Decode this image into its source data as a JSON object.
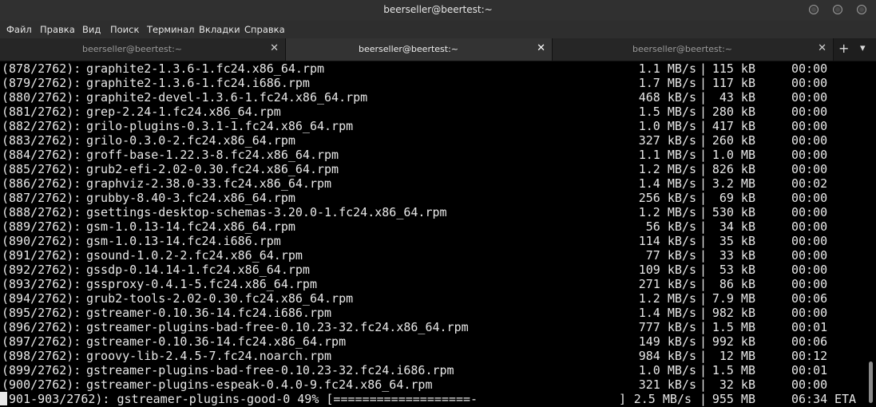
{
  "window": {
    "title": "beerseller@beertest:~"
  },
  "menu": [
    "Файл",
    "Правка",
    "Вид",
    "Поиск",
    "Терминал",
    "Вкладки",
    "Справка"
  ],
  "tabs": [
    {
      "label": "beerseller@beertest:~",
      "active": false
    },
    {
      "label": "beerseller@beertest:~",
      "active": true
    },
    {
      "label": "beerseller@beertest:~",
      "active": false
    }
  ],
  "tab_controls": {
    "new_tab": "+",
    "menu": "▾",
    "close": "✕"
  },
  "terminal": {
    "lines": [
      {
        "idx": "(878/2762):",
        "name": "graphite2-1.3.6-1.fc24.x86_64.rpm",
        "speed": "1.1 MB/s",
        "size": "115 kB",
        "eta": "00:00"
      },
      {
        "idx": "(879/2762):",
        "name": "graphite2-1.3.6-1.fc24.i686.rpm",
        "speed": "1.7 MB/s",
        "size": "117 kB",
        "eta": "00:00"
      },
      {
        "idx": "(880/2762):",
        "name": "graphite2-devel-1.3.6-1.fc24.x86_64.rpm",
        "speed": "468 kB/s",
        "size": "43 kB",
        "eta": "00:00"
      },
      {
        "idx": "(881/2762):",
        "name": "grep-2.24-1.fc24.x86_64.rpm",
        "speed": "1.5 MB/s",
        "size": "280 kB",
        "eta": "00:00"
      },
      {
        "idx": "(882/2762):",
        "name": "grilo-plugins-0.3.1-1.fc24.x86_64.rpm",
        "speed": "1.0 MB/s",
        "size": "417 kB",
        "eta": "00:00"
      },
      {
        "idx": "(883/2762):",
        "name": "grilo-0.3.0-2.fc24.x86_64.rpm",
        "speed": "327 kB/s",
        "size": "260 kB",
        "eta": "00:00"
      },
      {
        "idx": "(884/2762):",
        "name": "groff-base-1.22.3-8.fc24.x86_64.rpm",
        "speed": "1.1 MB/s",
        "size": "1.0 MB",
        "eta": "00:00"
      },
      {
        "idx": "(885/2762):",
        "name": "grub2-efi-2.02-0.30.fc24.x86_64.rpm",
        "speed": "1.2 MB/s",
        "size": "826 kB",
        "eta": "00:00"
      },
      {
        "idx": "(886/2762):",
        "name": "graphviz-2.38.0-33.fc24.x86_64.rpm",
        "speed": "1.4 MB/s",
        "size": "3.2 MB",
        "eta": "00:02"
      },
      {
        "idx": "(887/2762):",
        "name": "grubby-8.40-3.fc24.x86_64.rpm",
        "speed": "256 kB/s",
        "size": "69 kB",
        "eta": "00:00"
      },
      {
        "idx": "(888/2762):",
        "name": "gsettings-desktop-schemas-3.20.0-1.fc24.x86_64.rpm",
        "speed": "1.2 MB/s",
        "size": "530 kB",
        "eta": "00:00"
      },
      {
        "idx": "(889/2762):",
        "name": "gsm-1.0.13-14.fc24.x86_64.rpm",
        "speed": "56 kB/s",
        "size": "34 kB",
        "eta": "00:00"
      },
      {
        "idx": "(890/2762):",
        "name": "gsm-1.0.13-14.fc24.i686.rpm",
        "speed": "114 kB/s",
        "size": "35 kB",
        "eta": "00:00"
      },
      {
        "idx": "(891/2762):",
        "name": "gsound-1.0.2-2.fc24.x86_64.rpm",
        "speed": "77 kB/s",
        "size": "33 kB",
        "eta": "00:00"
      },
      {
        "idx": "(892/2762):",
        "name": "gssdp-0.14.14-1.fc24.x86_64.rpm",
        "speed": "109 kB/s",
        "size": "53 kB",
        "eta": "00:00"
      },
      {
        "idx": "(893/2762):",
        "name": "gssproxy-0.4.1-5.fc24.x86_64.rpm",
        "speed": "271 kB/s",
        "size": "86 kB",
        "eta": "00:00"
      },
      {
        "idx": "(894/2762):",
        "name": "grub2-tools-2.02-0.30.fc24.x86_64.rpm",
        "speed": "1.2 MB/s",
        "size": "7.9 MB",
        "eta": "00:06"
      },
      {
        "idx": "(895/2762):",
        "name": "gstreamer-0.10.36-14.fc24.i686.rpm",
        "speed": "1.4 MB/s",
        "size": "982 kB",
        "eta": "00:00"
      },
      {
        "idx": "(896/2762):",
        "name": "gstreamer-plugins-bad-free-0.10.23-32.fc24.x86_64.rpm",
        "speed": "777 kB/s",
        "size": "1.5 MB",
        "eta": "00:01"
      },
      {
        "idx": "(897/2762):",
        "name": "gstreamer-0.10.36-14.fc24.x86_64.rpm",
        "speed": "149 kB/s",
        "size": "992 kB",
        "eta": "00:06"
      },
      {
        "idx": "(898/2762):",
        "name": "groovy-lib-2.4.5-7.fc24.noarch.rpm",
        "speed": "984 kB/s",
        "size": "12 MB",
        "eta": "00:12"
      },
      {
        "idx": "(899/2762):",
        "name": "gstreamer-plugins-bad-free-0.10.23-32.fc24.i686.rpm",
        "speed": "1.0 MB/s",
        "size": "1.5 MB",
        "eta": "00:01"
      },
      {
        "idx": "(900/2762):",
        "name": "gstreamer-plugins-espeak-0.4.0-9.fc24.x86_64.rpm",
        "speed": "321 kB/s",
        "size": "32 kB",
        "eta": "00:00"
      }
    ],
    "progress": {
      "text": "(901-903/2762): gstreamer-plugins-good-0 49% [===================-",
      "bar_end": "]",
      "percent": 49,
      "speed": "2.5 MB/s",
      "size": "955 MB",
      "eta": "06:34",
      "eta_label": "ETA"
    }
  },
  "colors": {
    "terminal_bg": "#000000",
    "terminal_fg": "#e8e8e8",
    "titlebar_bg": "#303030",
    "tab_active_bg": "#333333"
  }
}
